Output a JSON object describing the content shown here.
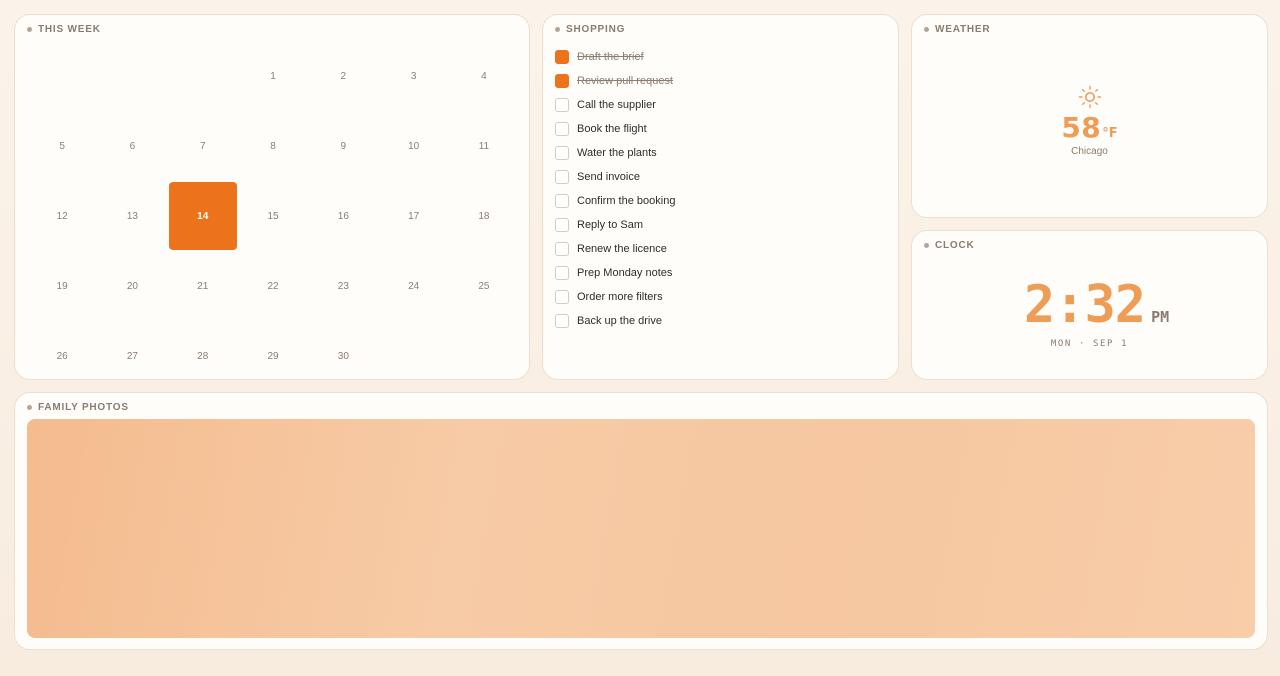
{
  "calendar": {
    "title": "THIS WEEK",
    "today": "14",
    "days": [
      "",
      "",
      "",
      "1",
      "2",
      "3",
      "4",
      "5",
      "6",
      "7",
      "8",
      "9",
      "10",
      "11",
      "12",
      "13",
      "14",
      "15",
      "16",
      "17",
      "18",
      "19",
      "20",
      "21",
      "22",
      "23",
      "24",
      "25",
      "26",
      "27",
      "28",
      "29",
      "30",
      "",
      ""
    ]
  },
  "shopping": {
    "title": "SHOPPING",
    "items": [
      {
        "text": "Draft the brief",
        "done": true
      },
      {
        "text": "Review pull request",
        "done": true
      },
      {
        "text": "Call the supplier",
        "done": false
      },
      {
        "text": "Book the flight",
        "done": false
      },
      {
        "text": "Water the plants",
        "done": false
      },
      {
        "text": "Send invoice",
        "done": false
      },
      {
        "text": "Confirm the booking",
        "done": false
      },
      {
        "text": "Reply to Sam",
        "done": false
      },
      {
        "text": "Renew the licence",
        "done": false
      },
      {
        "text": "Prep Monday notes",
        "done": false
      },
      {
        "text": "Order more filters",
        "done": false
      },
      {
        "text": "Back up the drive",
        "done": false
      }
    ]
  },
  "weather": {
    "title": "WEATHER",
    "icon": "sun-icon",
    "temp": "58",
    "unit": "°F",
    "city": "Chicago"
  },
  "clock": {
    "title": "CLOCK",
    "time": "2:32",
    "ampm": "PM",
    "date": "MON · SEP 1"
  },
  "photos": {
    "title": "FAMILY PHOTOS"
  },
  "colors": {
    "accent": "#ec731b",
    "accent_soft": "#ee9d57",
    "muted": "#8a7c70"
  }
}
